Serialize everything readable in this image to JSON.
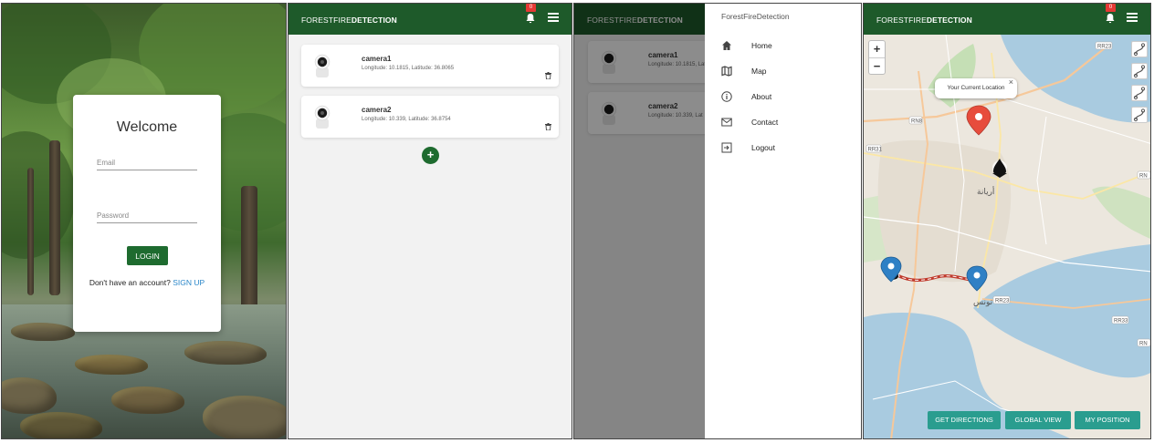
{
  "login": {
    "title": "Welcome",
    "email_placeholder": "Email",
    "password_placeholder": "Password",
    "login_button": "LOGIN",
    "no_account_text": "Don't have an account?",
    "signup_link": "SIGN UP"
  },
  "appbar": {
    "brand_light": "FORESTFIRE",
    "brand_bold": "DETECTION",
    "badge_count": "0",
    "bell_icon": "bell-icon",
    "menu_icon": "hamburger-menu-icon",
    "color": "#1e5a2a"
  },
  "cameras": [
    {
      "name": "camera1",
      "coords": "Longitude: 10.1815, Latitude: 36.8065"
    },
    {
      "name": "camera2",
      "coords": "Longitude: 10.339, Latitude: 36.8754"
    }
  ],
  "drawer_cameras": [
    {
      "name": "camera1",
      "coords": "Longitude: 10.1815, Lat"
    },
    {
      "name": "camera2",
      "coords": "Longitude: 10.339, Lat"
    }
  ],
  "drawer": {
    "title": "ForestFireDetection",
    "items": [
      {
        "label": "Home",
        "icon": "home-icon"
      },
      {
        "label": "Map",
        "icon": "map-icon"
      },
      {
        "label": "About",
        "icon": "info-icon"
      },
      {
        "label": "Contact",
        "icon": "mail-icon"
      },
      {
        "label": "Logout",
        "icon": "logout-icon"
      }
    ]
  },
  "map": {
    "zoom_in": "+",
    "zoom_out": "−",
    "popup_text": "Your Current Location",
    "popup_close": "×",
    "buttons": {
      "directions": "GET DIRECTIONS",
      "global_view": "GLOBAL VIEW",
      "my_position": "MY POSITION"
    },
    "road_labels": [
      "RR23",
      "RN8",
      "RR31",
      "RN",
      "RR23",
      "RR33",
      "RN"
    ],
    "place_labels": [
      "أريانة",
      "تونس"
    ],
    "accent": "#2a9d8f"
  }
}
